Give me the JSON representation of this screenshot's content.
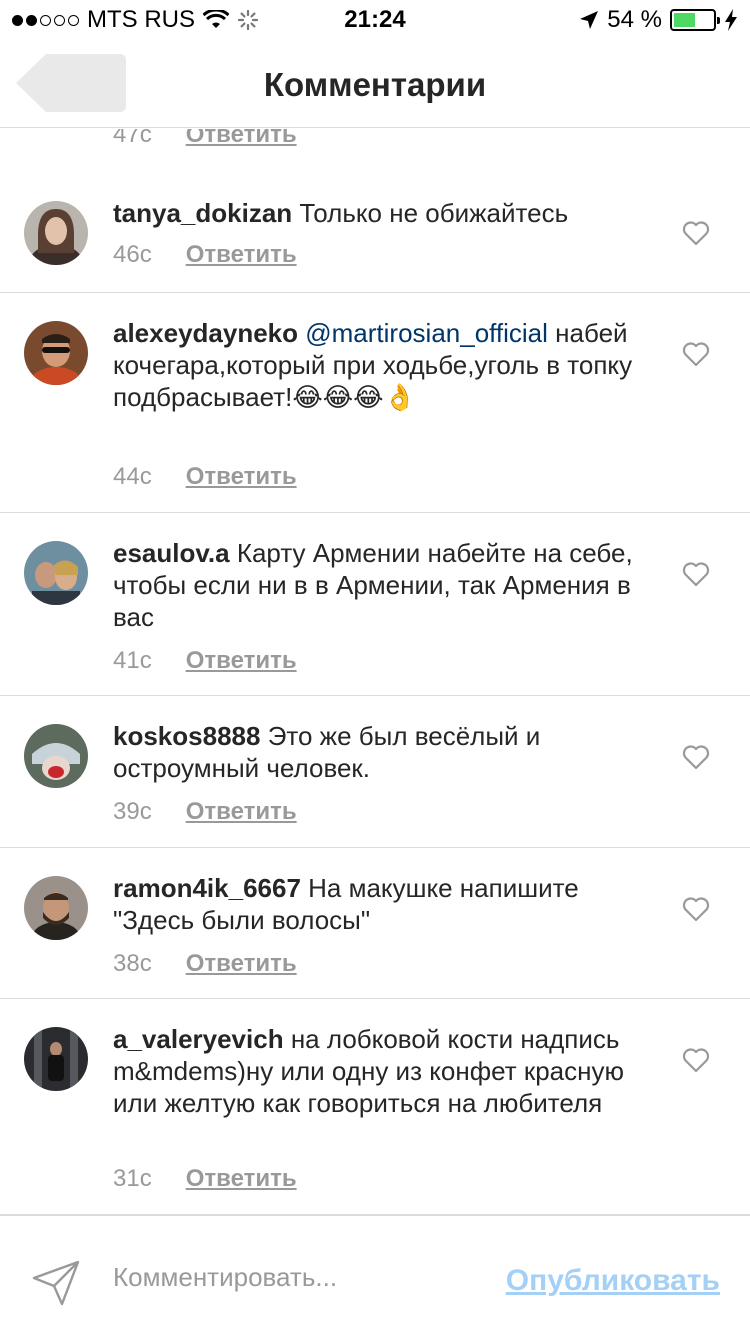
{
  "status_bar": {
    "carrier": "MTS RUS",
    "time": "21:24",
    "battery": "54 %",
    "battery_level": 0.54
  },
  "header": {
    "title": "Комментарии",
    "back_icon": "back-arrow-icon"
  },
  "partial_comment": {
    "time": "47с",
    "reply": "Ответить"
  },
  "comments": [
    {
      "username": "tanya_dokizan",
      "mention": "",
      "text": "Только не обижайтесь",
      "time": "46с",
      "reply": "Ответить"
    },
    {
      "username": "alexeydayneko",
      "mention": "@martirosian_official",
      "text": "набей кочегара,который при ходьбе,уголь в топку подбрасывает!😂😂😂👌",
      "time": "44с",
      "reply": "Ответить"
    },
    {
      "username": "esaulov.a",
      "mention": "",
      "text": "Карту Армении набейте на себе, чтобы если ни в в Армении, так Армения в вас",
      "time": "41с",
      "reply": "Ответить"
    },
    {
      "username": "koskos8888",
      "mention": "",
      "text": "Это же был весёлый и остроумный человек.",
      "time": "39с",
      "reply": "Ответить"
    },
    {
      "username": "ramon4ik_6667",
      "mention": "",
      "text": "На макушке напишите \"Здесь были волосы\"",
      "time": "38с",
      "reply": "Ответить"
    },
    {
      "username": "a_valeryevich",
      "mention": "",
      "text": "на лобковой кости надпись m&mdems)ну или одну из конфет красную или желтую как говориться на любителя",
      "time": "31с",
      "reply": "Ответить"
    }
  ],
  "composer": {
    "placeholder": "Комментировать...",
    "publish_label": "Опубликовать",
    "publish_color": "#a5d0f5"
  },
  "colors": {
    "text": "#262626",
    "muted": "#999999",
    "mention": "#003569",
    "divider": "#dbdbdb",
    "battery": "#4cd964"
  }
}
